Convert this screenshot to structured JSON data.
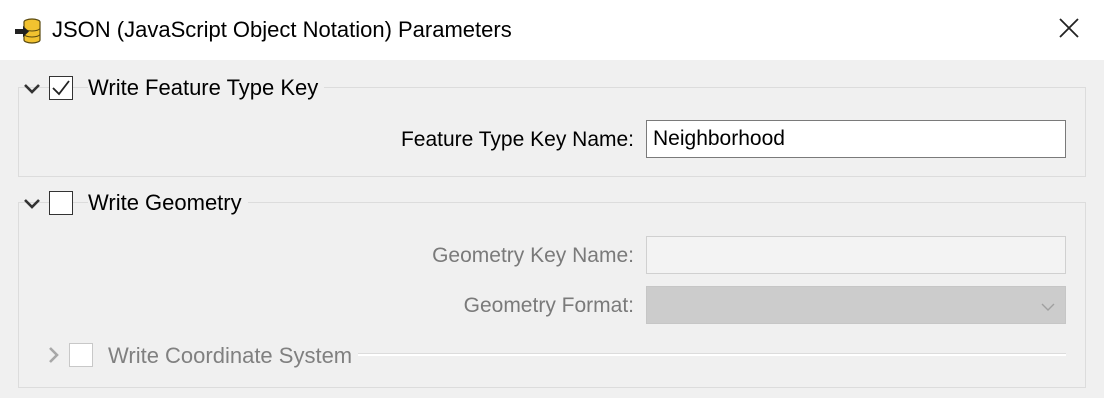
{
  "window": {
    "title": "JSON (JavaScript Object Notation) Parameters",
    "app_icon": "database-export-icon",
    "close_icon": "close-icon"
  },
  "groups": {
    "feature_type_key": {
      "label": "Write Feature Type Key",
      "checked": true,
      "expanded": true,
      "fields": {
        "key_name": {
          "label": "Feature Type Key Name:",
          "value": "Neighborhood"
        }
      }
    },
    "geometry": {
      "label": "Write Geometry",
      "checked": false,
      "expanded": true,
      "fields": {
        "key_name": {
          "label": "Geometry Key Name:",
          "value": "",
          "enabled": false
        },
        "format": {
          "label": "Geometry Format:",
          "value": "",
          "enabled": false
        }
      },
      "coordinate_system": {
        "label": "Write Coordinate System",
        "checked": false,
        "expanded": false,
        "enabled": false
      }
    }
  },
  "colors": {
    "background": "#f0f0f0",
    "titlebar": "#ffffff",
    "disabled_text": "#7a7a7a",
    "icon_yellow": "#f2c230"
  }
}
